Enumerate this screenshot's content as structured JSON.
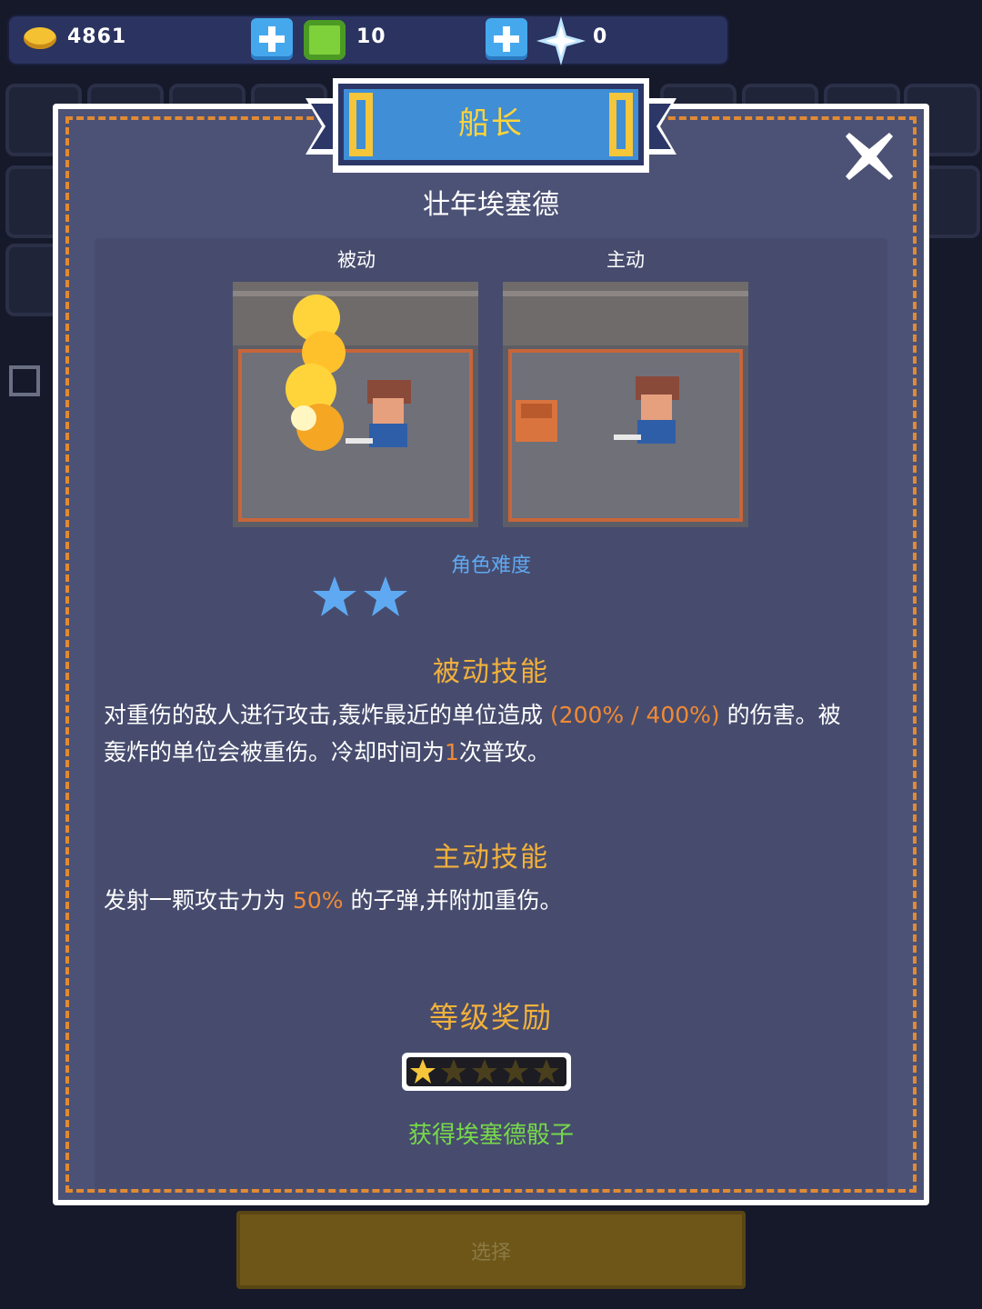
{
  "resources": {
    "gold": "4861",
    "gems": "10",
    "crystals": "0"
  },
  "dialog": {
    "class_title": "船长",
    "hero_name": "壮年埃塞德",
    "passive_tag": "被动",
    "active_tag": "主动",
    "difficulty_label": "角色难度",
    "difficulty_stars": 2,
    "passive_skill": {
      "title": "被动技能",
      "line1_a": "对重伤的敌人进行攻击,轰炸最近的单位造成",
      "line1_hl": "(200% / 400%)",
      "line1_b": "的伤害。被",
      "line2_a": "轰炸的单位会被重伤。冷却时间为",
      "line2_hl": "1",
      "line2_b": "次普攻。"
    },
    "active_skill": {
      "title": "主动技能",
      "text_a": "发射一颗攻击力为",
      "text_hl": "50%",
      "text_b": "的子弹,并附加重伤。"
    },
    "level_reward": {
      "title": "等级奖励",
      "stars_filled": 1,
      "stars_total": 5,
      "reward": "获得埃塞德骰子"
    }
  },
  "select_button": "选择",
  "colors": {
    "accent_orange": "#e18a33",
    "title_gold": "#f2b13b",
    "difficulty_blue": "#5fa9f2",
    "reward_green": "#77d94a",
    "highlight_orange": "#f08a35"
  }
}
